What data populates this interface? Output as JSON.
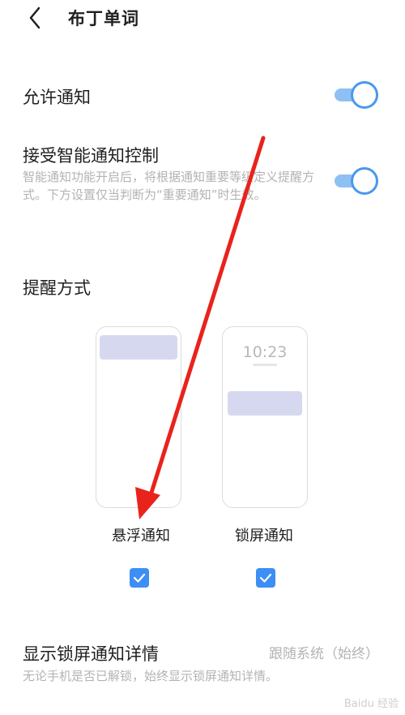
{
  "header": {
    "title": "布丁单词",
    "back_icon": "chevron-left-icon"
  },
  "allow_notify": {
    "title": "允许通知",
    "toggle_on": true
  },
  "smart_notify": {
    "title": "接受智能通知控制",
    "desc": "智能通知功能开启后，将根据通知重要等级定义提醒方式。下方设置仅当判断为“重要通知”时生效。",
    "toggle_on": true
  },
  "reminder": {
    "title": "提醒方式",
    "options": [
      {
        "label": "悬浮通知",
        "checked": true
      },
      {
        "label": "锁屏通知",
        "checked": true,
        "preview_time": "10:23"
      }
    ]
  },
  "lockscreen_detail": {
    "title": "显示锁屏通知详情",
    "value": "跟随系统（始终）",
    "desc": "无论手机是否已解锁，始终显示锁屏通知详情。"
  },
  "watermark": "Baidu 经验",
  "colors": {
    "accent": "#3d8ef5",
    "arrow": "#e8231c"
  }
}
